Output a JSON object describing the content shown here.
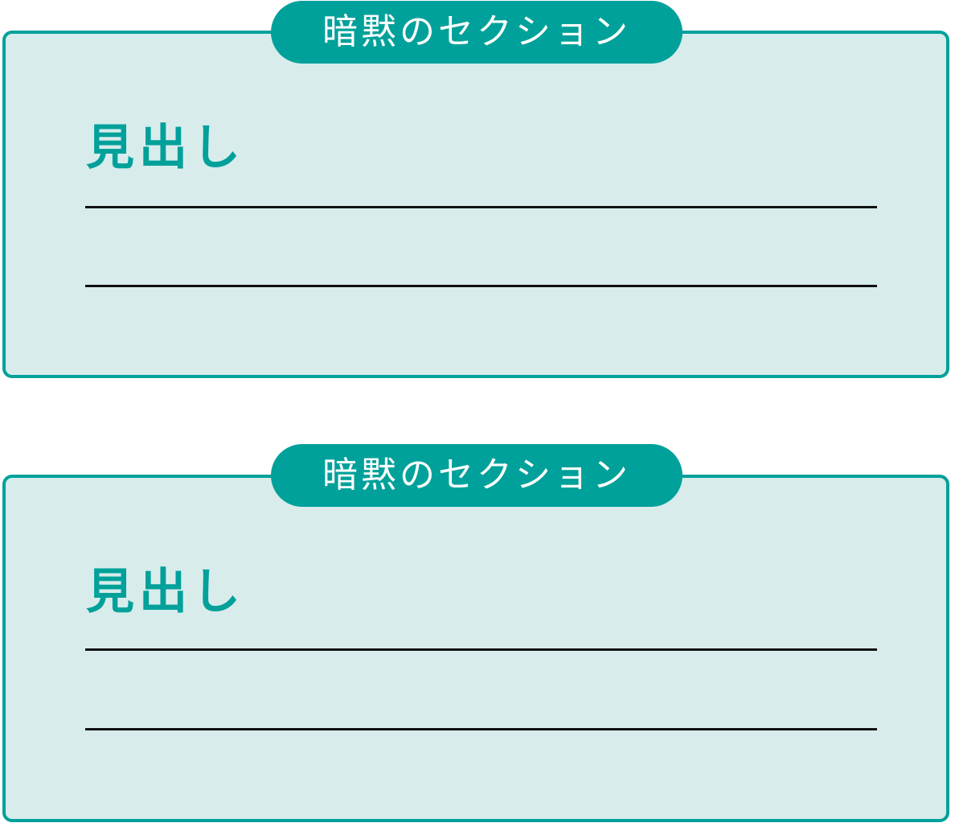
{
  "sections": [
    {
      "tag": "暗黙のセクション",
      "heading": "見出し"
    },
    {
      "tag": "暗黙のセクション",
      "heading": "見出し"
    }
  ],
  "colors": {
    "accent": "#00a19a",
    "panel_fill": "#d8ecec",
    "rule": "#111111"
  }
}
